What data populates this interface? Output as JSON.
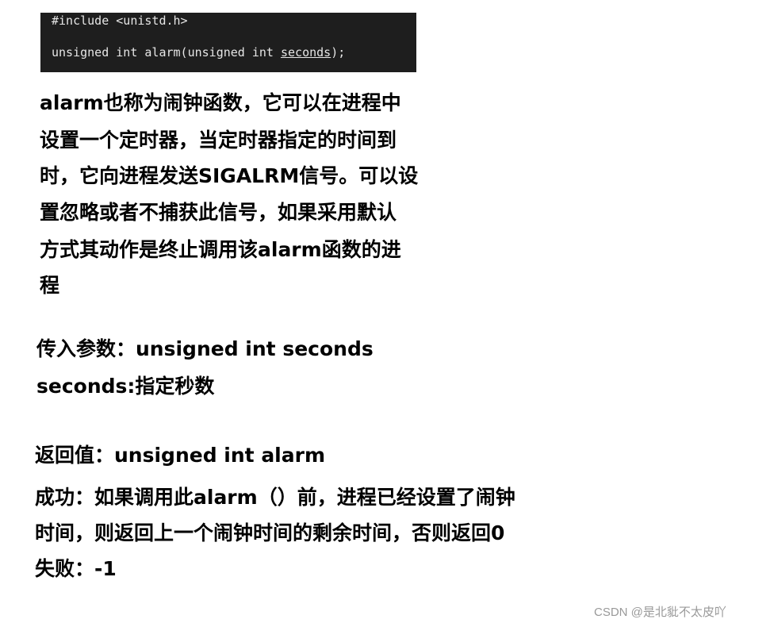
{
  "code": {
    "include": "#include <unistd.h>",
    "sig_prefix": "unsigned int alarm(unsigned int ",
    "sig_param": "seconds",
    "sig_suffix": ");"
  },
  "description_lines": [
    "alarm也称为闹钟函数，它可以在进程中",
    "设置一个定时器，当定时器指定的时间到",
    "时，它向进程发送SIGALRM信号。可以设",
    "置忽略或者不捕获此信号，如果采用默认",
    "方式其动作是终止调用该alarm函数的进",
    "程"
  ],
  "params": {
    "heading": "传入参数：unsigned int seconds",
    "detail": "seconds:指定秒数"
  },
  "return": {
    "heading": "返回值：unsigned int alarm",
    "success_lines": [
      "成功：如果调用此alarm（）前，进程已经设置了闹钟",
      "时间，则返回上一个闹钟时间的剩余时间，否则返回0"
    ],
    "failure": "失败：-1"
  },
  "watermark": "CSDN @是北豼不太皮吖"
}
